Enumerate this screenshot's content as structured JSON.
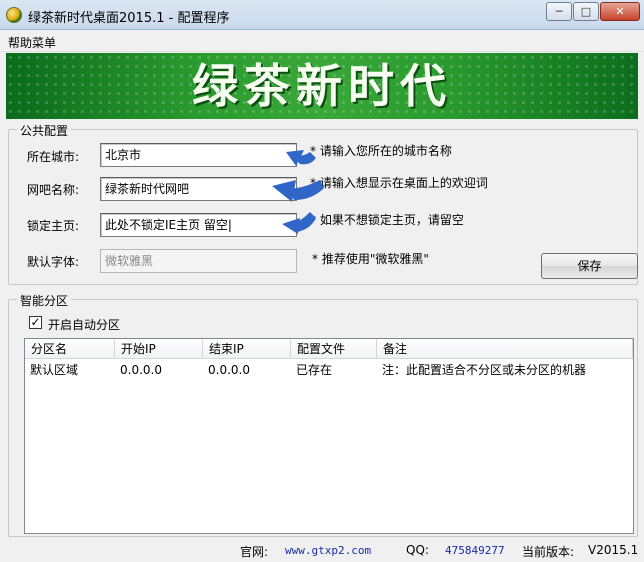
{
  "window": {
    "title": "绿茶新时代桌面2015.1 - 配置程序",
    "min_label": "─",
    "max_label": "□",
    "close_label": "✕"
  },
  "menu": {
    "help_label": "帮助菜单"
  },
  "banner": {
    "text": "绿茶新时代"
  },
  "public_config": {
    "legend": "公共配置",
    "city_label": "所在城市:",
    "city_value": "北京市",
    "city_hint": "* 请输入您所在的城市名称",
    "cafe_label": "网吧名称:",
    "cafe_value": "绿茶新时代网吧",
    "cafe_hint": "* 请输入想显示在桌面上的欢迎词",
    "home_label": "锁定主页:",
    "home_value": "此处不锁定IE主页 留空|",
    "home_hint": "* 如果不想锁定主页，请留空",
    "font_label": "默认字体:",
    "font_value": "微软雅黑",
    "font_hint": "* 推荐使用\"微软雅黑\"",
    "save_label": "保存"
  },
  "smart_partition": {
    "legend": "智能分区",
    "checkbox_checked": true,
    "checkbox_mark": "✓",
    "checkbox_label": "开启自动分区",
    "columns": [
      "分区名",
      "开始IP",
      "结束IP",
      "配置文件",
      "备注"
    ],
    "rows": [
      [
        "默认区域",
        "0.0.0.0",
        "0.0.0.0",
        "已存在",
        "注：此配置适合不分区或未分区的机器"
      ]
    ]
  },
  "status": {
    "site_label": "官网:",
    "site_value": "www.gtxp2.com",
    "qq_label": "QQ:",
    "qq_value": "475849277",
    "version_label": "当前版本:",
    "version_value": "V2015.1"
  },
  "colors": {
    "banner_green": "#2a9a2e",
    "arrow_blue": "#2f66c8",
    "link_blue": "#1a2ba8"
  }
}
